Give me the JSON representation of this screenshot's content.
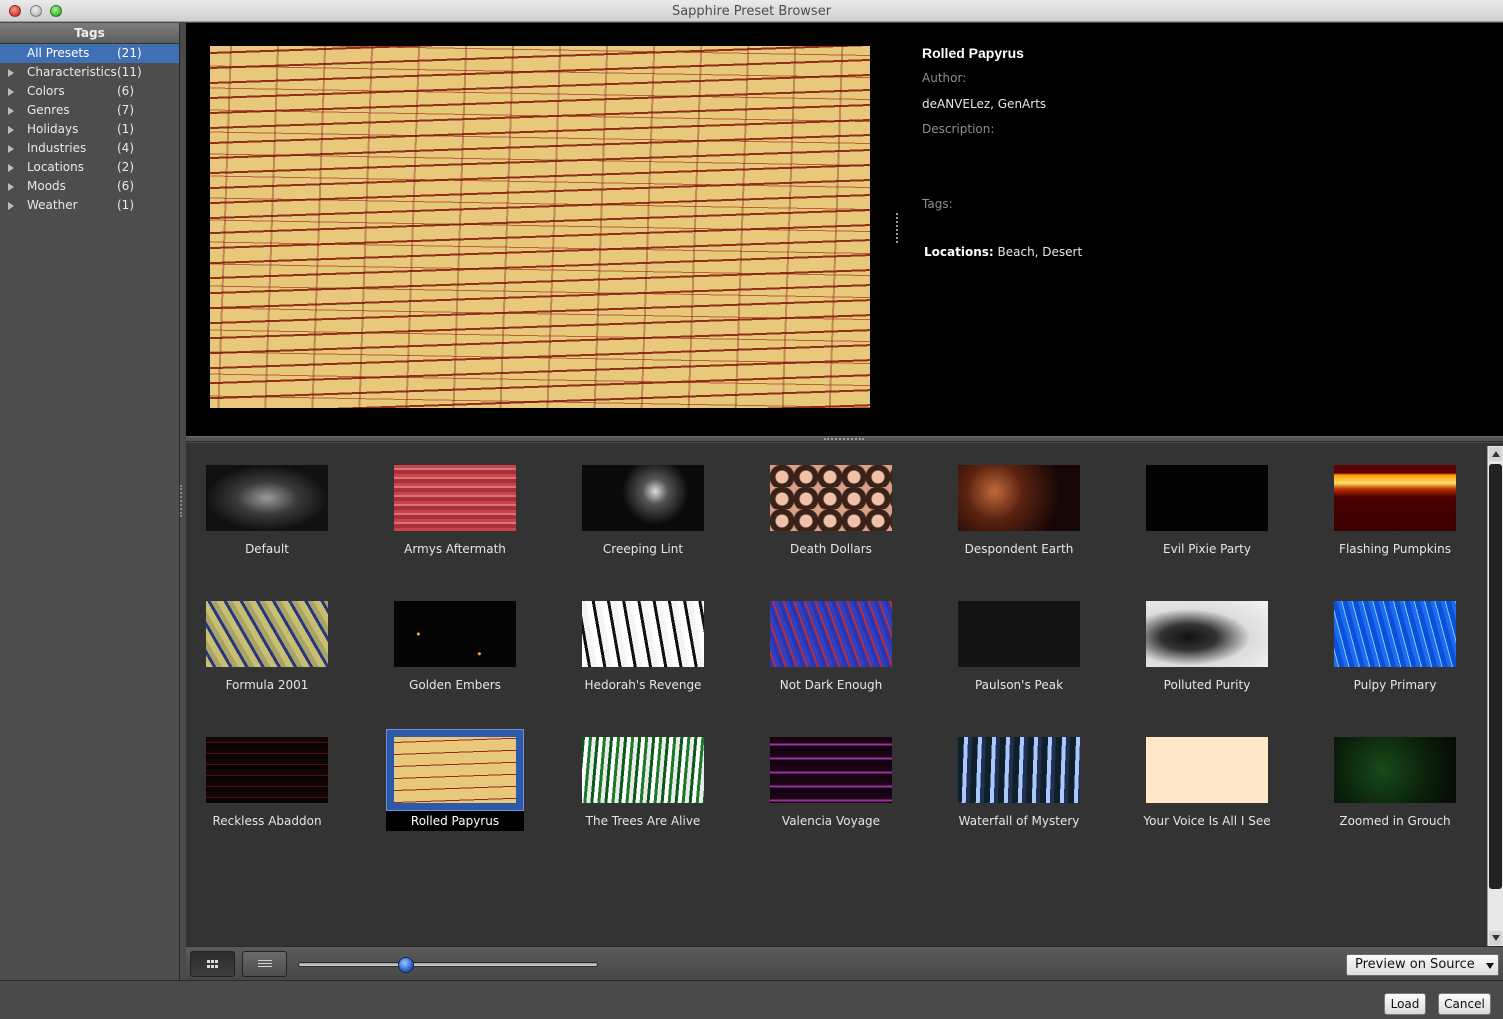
{
  "window": {
    "title": "Sapphire Preset Browser"
  },
  "sidebar": {
    "header": "Tags",
    "items": [
      {
        "label": "All Presets",
        "count": "(21)",
        "expandable": false,
        "selected": true
      },
      {
        "label": "Characteristics",
        "count": "(11)",
        "expandable": true,
        "selected": false
      },
      {
        "label": "Colors",
        "count": "(6)",
        "expandable": true,
        "selected": false
      },
      {
        "label": "Genres",
        "count": "(7)",
        "expandable": true,
        "selected": false
      },
      {
        "label": "Holidays",
        "count": "(1)",
        "expandable": true,
        "selected": false
      },
      {
        "label": "Industries",
        "count": "(4)",
        "expandable": true,
        "selected": false
      },
      {
        "label": "Locations",
        "count": "(2)",
        "expandable": true,
        "selected": false
      },
      {
        "label": "Moods",
        "count": "(6)",
        "expandable": true,
        "selected": false
      },
      {
        "label": "Weather",
        "count": "(1)",
        "expandable": true,
        "selected": false
      }
    ]
  },
  "details": {
    "name": "Rolled Papyrus",
    "author_label": "Author:",
    "author": "deANVELez, GenArts",
    "description_label": "Description:",
    "tags_label": "Tags:",
    "tags_category": "Locations:",
    "tags_values": " Beach, Desert"
  },
  "presets": [
    {
      "name": "Default",
      "thumb": "default"
    },
    {
      "name": "Armys Aftermath",
      "thumb": "armys"
    },
    {
      "name": "Creeping Lint",
      "thumb": "lint"
    },
    {
      "name": "Death Dollars",
      "thumb": "dollars"
    },
    {
      "name": "Despondent Earth",
      "thumb": "earth"
    },
    {
      "name": "Evil Pixie Party",
      "thumb": "pixie"
    },
    {
      "name": "Flashing Pumpkins",
      "thumb": "pumpkins"
    },
    {
      "name": "Formula 2001",
      "thumb": "formula"
    },
    {
      "name": "Golden Embers",
      "thumb": "embers"
    },
    {
      "name": "Hedorah's Revenge",
      "thumb": "hedorah"
    },
    {
      "name": "Not Dark Enough",
      "thumb": "notdark"
    },
    {
      "name": "Paulson's Peak",
      "thumb": "paulson"
    },
    {
      "name": "Polluted Purity",
      "thumb": "polluted"
    },
    {
      "name": "Pulpy Primary",
      "thumb": "pulpy"
    },
    {
      "name": "Reckless Abaddon",
      "thumb": "reckless"
    },
    {
      "name": "Rolled Papyrus",
      "thumb": "papyrus",
      "selected": true
    },
    {
      "name": "The Trees Are Alive",
      "thumb": "trees"
    },
    {
      "name": "Valencia Voyage",
      "thumb": "valencia"
    },
    {
      "name": "Waterfall of Mystery",
      "thumb": "waterfall"
    },
    {
      "name": "Your Voice Is All I See",
      "thumb": "voice"
    },
    {
      "name": "Zoomed in Grouch",
      "thumb": "grouch"
    }
  ],
  "toolbar": {
    "grid_view_icon": "grid-icon",
    "list_view_icon": "list-icon",
    "thumbnail_size": 0.36,
    "preview_select": "Preview on Source"
  },
  "footer": {
    "load": "Load",
    "cancel": "Cancel"
  }
}
